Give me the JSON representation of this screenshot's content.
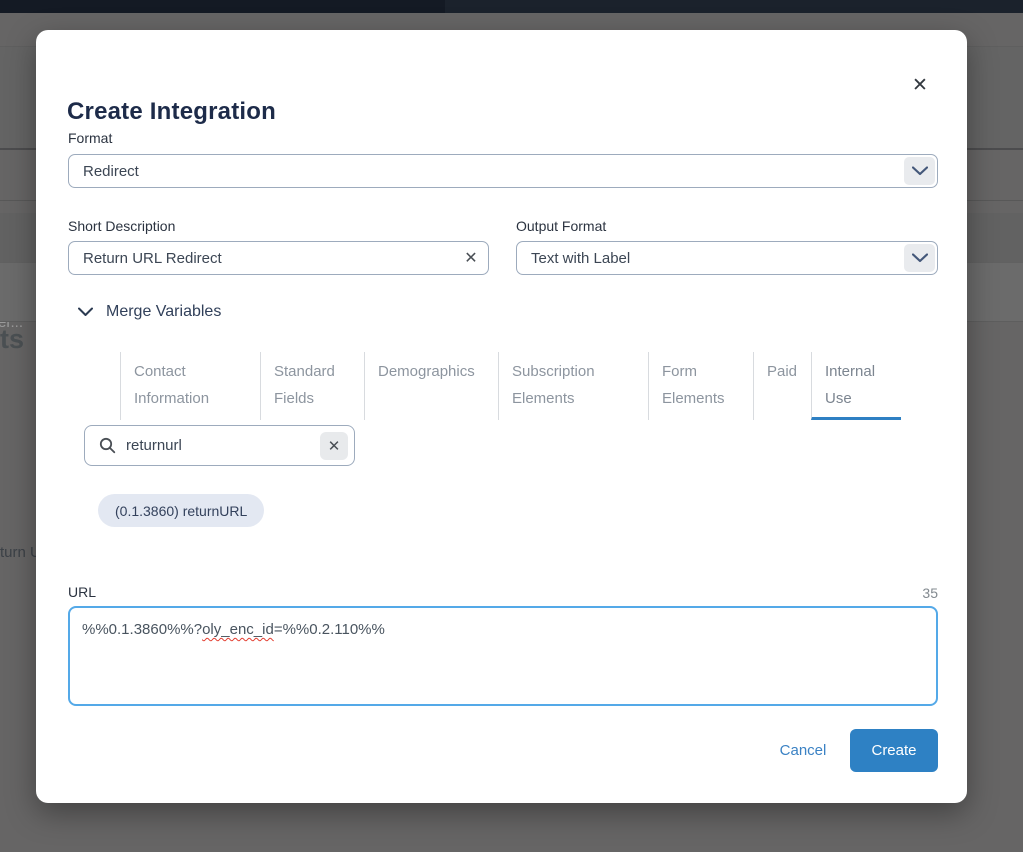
{
  "background": {
    "filter_placeholder_fragment": "er...",
    "row_text_fragment": "turn U",
    "heading_fragment": "ts"
  },
  "modal": {
    "title": "Create Integration",
    "fields": {
      "format": {
        "label": "Format",
        "value": "Redirect"
      },
      "short_description": {
        "label": "Short Description",
        "value": "Return URL Redirect"
      },
      "output_format": {
        "label": "Output Format",
        "value": "Text with Label"
      },
      "url": {
        "label": "URL",
        "char_count": "35",
        "value_prefix": "%%0.1.3860%%?",
        "value_misspelled": "oly_enc_id",
        "value_suffix": "=%%0.2.110%%"
      }
    },
    "merge_variables": {
      "title": "Merge Variables",
      "tabs": [
        {
          "label": "Contact Information",
          "selected": false
        },
        {
          "label": "Standard Fields",
          "selected": false
        },
        {
          "label": "Demographics",
          "selected": false
        },
        {
          "label": "Subscription Elements",
          "selected": false
        },
        {
          "label": "Form Elements",
          "selected": false
        },
        {
          "label": "Paid",
          "selected": false
        },
        {
          "label": "Internal Use",
          "selected": true
        }
      ],
      "search": {
        "value": "returnurl"
      },
      "result_pill": "(0.1.3860) returnURL"
    },
    "actions": {
      "cancel": "Cancel",
      "create": "Create"
    }
  },
  "icons": {
    "close": "✕",
    "clear": "✕"
  },
  "colors": {
    "accent_blue": "#2e81c4",
    "tab_underline": "#2e80c3",
    "focus_border": "#54a9e8",
    "pill_background": "#e3e8f2",
    "spellcheck_red": "#e23b2e",
    "title_navy": "#1d2b49"
  }
}
